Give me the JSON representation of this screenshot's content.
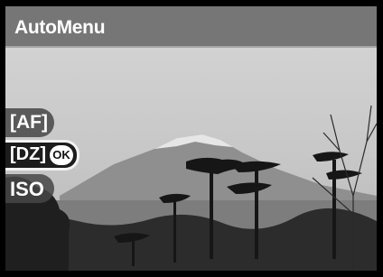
{
  "title_bar": {
    "title": "AutoMenu"
  },
  "menu": {
    "items": [
      {
        "label": "[AF]"
      },
      {
        "label": "[DZ]",
        "selected": true,
        "badge": "OK"
      },
      {
        "label": "ISO"
      }
    ]
  },
  "colors": {
    "title_bar": "#6a6a6a",
    "selected_border": "#f2f2f2",
    "text": "#ffffff"
  }
}
